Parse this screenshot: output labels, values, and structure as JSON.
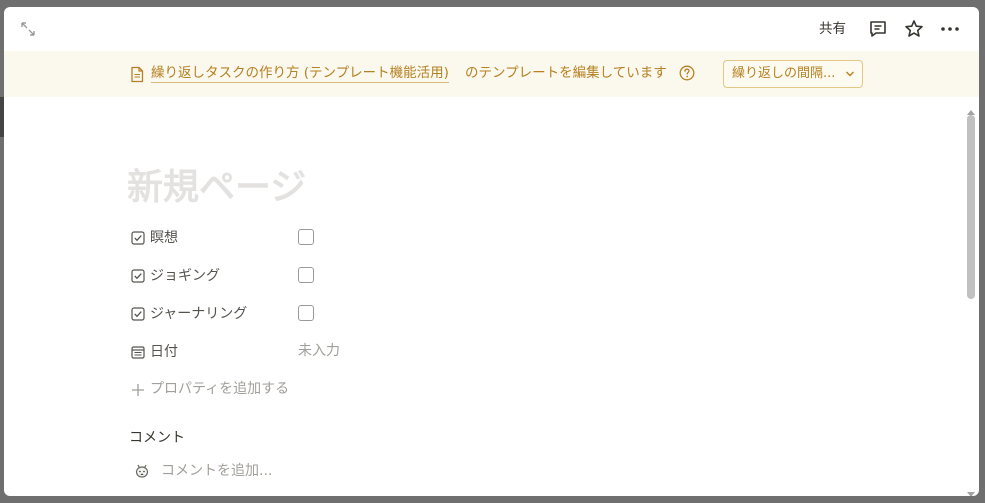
{
  "topbar": {
    "share_label": "共有",
    "icons": [
      "expand-icon",
      "comment-icon",
      "star-icon",
      "more-icon"
    ]
  },
  "banner": {
    "template_link": "繰り返しタスクの作り方 (テンプレート機能活用)",
    "text": "のテンプレートを編集しています",
    "select_value": "繰り返しの間隔...",
    "accent_color": "#b68122",
    "background_color": "#fbf8ee"
  },
  "page": {
    "title_placeholder": "新規ページ"
  },
  "properties": [
    {
      "label": "瞑想",
      "type": "checkbox",
      "checked": false,
      "icon": "checkbox-type-icon"
    },
    {
      "label": "ジョギング",
      "type": "checkbox",
      "checked": false,
      "icon": "checkbox-type-icon"
    },
    {
      "label": "ジャーナリング",
      "type": "checkbox",
      "checked": false,
      "icon": "checkbox-type-icon"
    },
    {
      "label": "日付",
      "type": "date",
      "value": "未入力",
      "icon": "calendar-icon"
    }
  ],
  "add_property_label": "プロパティを追加する",
  "comments": {
    "heading": "コメント",
    "placeholder": "コメントを追加..."
  }
}
